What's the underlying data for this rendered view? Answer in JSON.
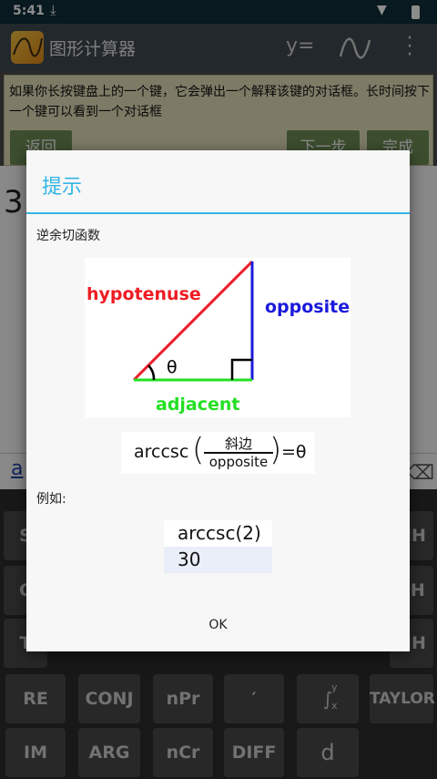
{
  "statusbar": {
    "time": "5:41",
    "download_icon": "download-icon",
    "wifi_icon": "wifi-icon",
    "battery_icon": "battery-icon"
  },
  "appbar": {
    "title": "图形计算器",
    "yeq_label": "y=",
    "wave_icon": "wave-icon",
    "menu_icon": "overflow-menu-icon"
  },
  "help": {
    "text": "如果你长按键盘上的一个键，它会弹出一个解释该键的对话框。长时间按下一个键可以看到一个对话框",
    "back_label": "返回",
    "next_label": "下一步",
    "done_label": "完成"
  },
  "work": {
    "expression": "3",
    "input_text": "a"
  },
  "keyboard": {
    "side_keys_left": [
      "S",
      "C",
      "T"
    ],
    "side_keys_right": [
      "NH",
      "SH",
      "NH"
    ],
    "row4": [
      "RE",
      "CONJ",
      "nPr",
      "′",
      "∫",
      "TAYLOR"
    ],
    "row5": [
      "IM",
      "ARG",
      "nCr",
      "DIFF",
      "d"
    ],
    "integral_sup": "y",
    "integral_sub": "x"
  },
  "dialog": {
    "title": "提示",
    "subtitle": "逆余切函数",
    "diagram": {
      "hypotenuse": "hypotenuse",
      "opposite": "opposite",
      "adjacent": "adjacent",
      "angle": "θ",
      "colors": {
        "hypotenuse": "#ee1c24",
        "opposite": "#1a1adb",
        "adjacent": "#22e022"
      }
    },
    "formula": {
      "left": "arccsc",
      "numerator": "斜边",
      "denominator": "opposite",
      "right": "=θ"
    },
    "example_label": "例如:",
    "example_input": "arccsc(2)",
    "example_output": "30",
    "ok_label": "OK"
  },
  "colors": {
    "accent": "#33b5e5",
    "help_bg": "#e3e0bb",
    "help_button": "#6f8f57"
  }
}
